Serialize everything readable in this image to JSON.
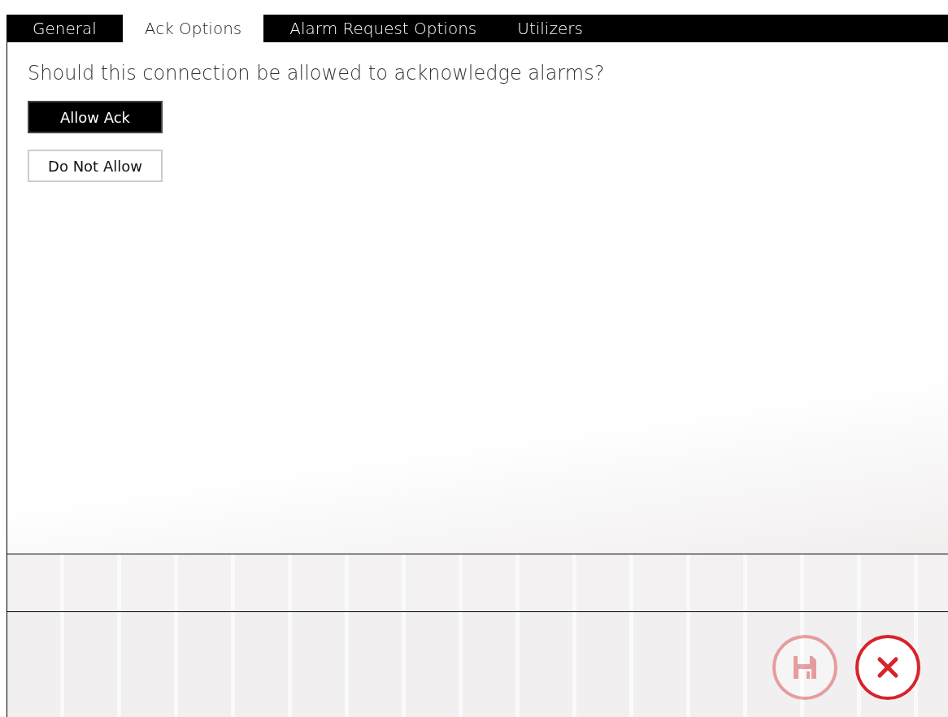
{
  "tabs": [
    {
      "label": "General",
      "selected": false
    },
    {
      "label": "Ack Options",
      "selected": true
    },
    {
      "label": "Alarm Request Options",
      "selected": false
    },
    {
      "label": "Utilizers",
      "selected": false
    }
  ],
  "question": "Should this connection be allowed to acknowledge alarms?",
  "options": [
    {
      "label": "Allow Ack",
      "selected": true
    },
    {
      "label": "Do Not Allow",
      "selected": false
    }
  ],
  "actions": [
    {
      "kind": "save",
      "disabled": true
    },
    {
      "kind": "cancel",
      "disabled": false
    }
  ]
}
